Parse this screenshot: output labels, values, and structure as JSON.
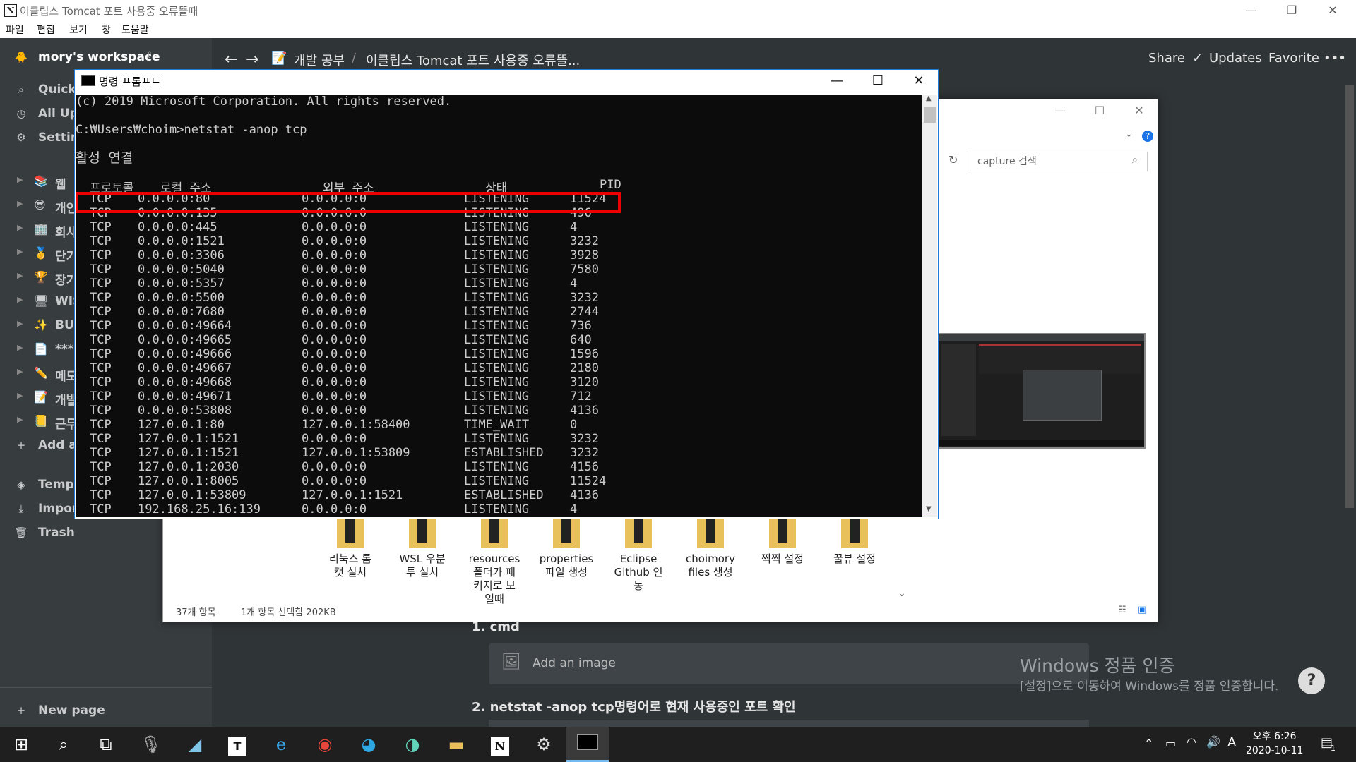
{
  "window": {
    "title": "이클립스 Tomcat 포트 사용중 오류뜰때",
    "menu": [
      "파일",
      "편집",
      "보기",
      "창",
      "도움말"
    ]
  },
  "sidebar": {
    "workspace": "mory's workspace",
    "top_items": [
      {
        "icon": "search-icon",
        "label": "Quick"
      },
      {
        "icon": "clock-icon",
        "label": "All Up"
      },
      {
        "icon": "gear-icon",
        "label": "Settin"
      }
    ],
    "pages": [
      {
        "emoji": "📚",
        "label": "웹"
      },
      {
        "emoji": "😎",
        "label": "개인"
      },
      {
        "emoji": "🏢",
        "label": "회사"
      },
      {
        "emoji": "🥇",
        "label": "단기"
      },
      {
        "emoji": "🏆",
        "label": "장기"
      },
      {
        "emoji": "🖥",
        "label": "WIS"
      },
      {
        "emoji": "✨",
        "label": "BUG"
      },
      {
        "emoji": "📄",
        "label": "****"
      },
      {
        "emoji": "✏️",
        "label": "메모"
      },
      {
        "emoji": "📝",
        "label": "개발"
      },
      {
        "emoji": "📒",
        "label": "근무"
      }
    ],
    "add_label": "Add a",
    "bottom_items": [
      {
        "icon": "templates-icon",
        "label": "Templ"
      },
      {
        "icon": "import-icon",
        "label": "Impor"
      },
      {
        "icon": "trash-icon",
        "label": "Trash"
      }
    ],
    "new_page": "New page"
  },
  "topbar": {
    "breadcrumb_parent": "개발 공부",
    "breadcrumb_current": "이클립스 Tomcat 포트 사용중 오류뜰...",
    "share": "Share",
    "updates": "Updates",
    "favorite": "Favorite",
    "more": "•••"
  },
  "explorer": {
    "search_placeholder": "capture 검색",
    "folders": [
      {
        "name": "리눅스 톰\n캣 설치"
      },
      {
        "name": "WSL 우분\n투 설치"
      },
      {
        "name": "resources\n폴더가 패\n키지로 보\n일때"
      },
      {
        "name": "properties\n파일 생성"
      },
      {
        "name": "Eclipse\nGithub 연\n동"
      },
      {
        "name": "choimory\nfiles 생성"
      },
      {
        "name": "찍찍 설정"
      },
      {
        "name": "꿀뷰 설정"
      }
    ],
    "item_count": "37개 항목",
    "selection": "1개 항목 선택함 202KB"
  },
  "cmd": {
    "title": "명령 프롬프트",
    "copyright": "(c) 2019 Microsoft Corporation. All rights reserved.",
    "prompt": "C:₩Users₩choim>netstat -anop tcp",
    "section": "활성 연결",
    "headers": [
      "프로토콜",
      "로컬 주소",
      "외부 주소",
      "상태",
      "PID"
    ],
    "rows": [
      [
        "TCP",
        "0.0.0.0:80",
        "0.0.0.0:0",
        "LISTENING",
        "11524"
      ],
      [
        "TCP",
        "0.0.0.0:135",
        "0.0.0.0:0",
        "LISTENING",
        "496"
      ],
      [
        "TCP",
        "0.0.0.0:445",
        "0.0.0.0:0",
        "LISTENING",
        "4"
      ],
      [
        "TCP",
        "0.0.0.0:1521",
        "0.0.0.0:0",
        "LISTENING",
        "3232"
      ],
      [
        "TCP",
        "0.0.0.0:3306",
        "0.0.0.0:0",
        "LISTENING",
        "3928"
      ],
      [
        "TCP",
        "0.0.0.0:5040",
        "0.0.0.0:0",
        "LISTENING",
        "7580"
      ],
      [
        "TCP",
        "0.0.0.0:5357",
        "0.0.0.0:0",
        "LISTENING",
        "4"
      ],
      [
        "TCP",
        "0.0.0.0:5500",
        "0.0.0.0:0",
        "LISTENING",
        "3232"
      ],
      [
        "TCP",
        "0.0.0.0:7680",
        "0.0.0.0:0",
        "LISTENING",
        "2744"
      ],
      [
        "TCP",
        "0.0.0.0:49664",
        "0.0.0.0:0",
        "LISTENING",
        "736"
      ],
      [
        "TCP",
        "0.0.0.0:49665",
        "0.0.0.0:0",
        "LISTENING",
        "640"
      ],
      [
        "TCP",
        "0.0.0.0:49666",
        "0.0.0.0:0",
        "LISTENING",
        "1596"
      ],
      [
        "TCP",
        "0.0.0.0:49667",
        "0.0.0.0:0",
        "LISTENING",
        "2180"
      ],
      [
        "TCP",
        "0.0.0.0:49668",
        "0.0.0.0:0",
        "LISTENING",
        "3120"
      ],
      [
        "TCP",
        "0.0.0.0:49671",
        "0.0.0.0:0",
        "LISTENING",
        "712"
      ],
      [
        "TCP",
        "0.0.0.0:53808",
        "0.0.0.0:0",
        "LISTENING",
        "4136"
      ],
      [
        "TCP",
        "127.0.0.1:80",
        "127.0.0.1:58400",
        "TIME_WAIT",
        "0"
      ],
      [
        "TCP",
        "127.0.0.1:1521",
        "0.0.0.0:0",
        "LISTENING",
        "3232"
      ],
      [
        "TCP",
        "127.0.0.1:1521",
        "127.0.0.1:53809",
        "ESTABLISHED",
        "3232"
      ],
      [
        "TCP",
        "127.0.0.1:2030",
        "0.0.0.0:0",
        "LISTENING",
        "4156"
      ],
      [
        "TCP",
        "127.0.0.1:8005",
        "0.0.0.0:0",
        "LISTENING",
        "11524"
      ],
      [
        "TCP",
        "127.0.0.1:53809",
        "127.0.0.1:1521",
        "ESTABLISHED",
        "4136"
      ],
      [
        "TCP",
        "192.168.25.16:139",
        "0.0.0.0:0",
        "LISTENING",
        "4"
      ]
    ]
  },
  "page": {
    "step1": "1.  cmd",
    "add_image": "Add an image",
    "step2": "2.  netstat -anop tcp명령어로 현재 사용중인 포트 확인"
  },
  "watermark": {
    "line1": "Windows 정품 인증",
    "line2": "[설정]으로 이동하여 Windows를 정품 인증합니다."
  },
  "help": "?",
  "taskbar": {
    "time": "오후 6:26",
    "date": "2020-10-11",
    "ime": "A",
    "notifications": "1"
  }
}
